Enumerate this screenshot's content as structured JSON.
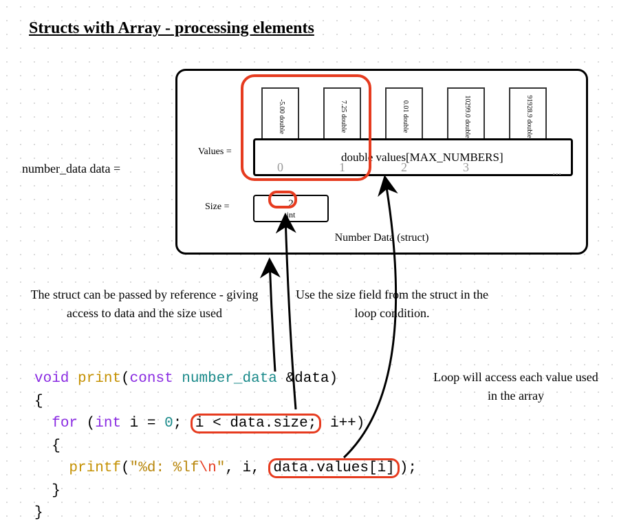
{
  "title": "Structs with Array - processing elements",
  "lhs": "number_data data =",
  "struct": {
    "caption": "Number Data (struct)",
    "values_label": "Values =",
    "size_label": "Size =",
    "array_text": "double values[MAX_NUMBERS]",
    "slots": [
      {
        "value": "-5.00",
        "type": "double",
        "index": "0"
      },
      {
        "value": "7.25",
        "type": "double",
        "index": "1"
      },
      {
        "value": "0.01",
        "type": "double",
        "index": "2"
      },
      {
        "value": "10299.0",
        "type": "double",
        "index": "3"
      },
      {
        "value": "91928.9",
        "type": "double",
        "index": "..."
      }
    ],
    "size_value": "2",
    "size_type": "int"
  },
  "notes": {
    "n1": "The struct can be passed by reference - giving access to data and the size used",
    "n2": "Use the size field from the struct in the loop condition.",
    "n3": "Loop will access each value used in the array"
  },
  "code": {
    "kw_void": "void",
    "fn_print": "print",
    "kw_const": "const",
    "ty_number_data": "number_data",
    "param": "&data",
    "kw_for": "for",
    "kw_int": "int",
    "var_i": "i",
    "lit_zero": "0",
    "cond": "i < data.size;",
    "inc": "i++",
    "fn_printf": "printf",
    "str1": "\"%d: %lf",
    "esc": "\\n",
    "str2": "\"",
    "arg_i": "i",
    "arg_val": "data.values[i]"
  }
}
